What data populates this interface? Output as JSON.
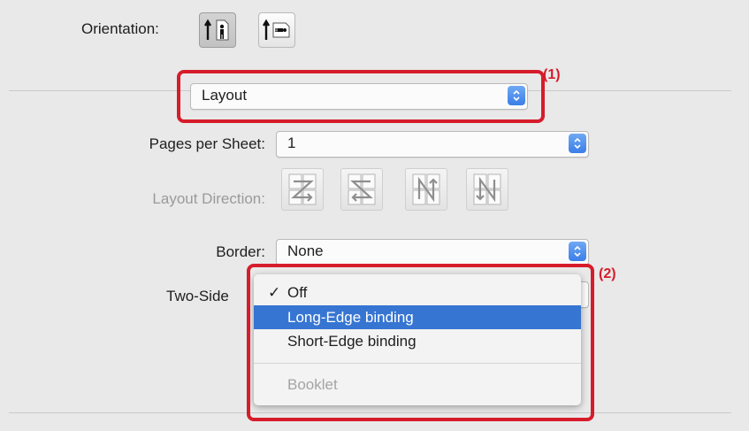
{
  "orientation": {
    "label": "Orientation:",
    "portrait_icon": "portrait-person-icon",
    "landscape_icon": "landscape-person-icon",
    "selected": "portrait"
  },
  "section_popup": {
    "value": "Layout"
  },
  "pages_per_sheet": {
    "label": "Pages per Sheet:",
    "value": "1"
  },
  "layout_direction": {
    "label": "Layout Direction:",
    "icons": [
      "z-order-icon",
      "reverse-z-order-icon",
      "n-order-icon",
      "reverse-n-order-icon"
    ]
  },
  "border": {
    "label": "Border:",
    "value": "None"
  },
  "two_sided": {
    "label": "Two-Side",
    "menu": [
      {
        "label": "Off",
        "checked": true,
        "highlighted": false,
        "enabled": true
      },
      {
        "label": "Long-Edge binding",
        "checked": false,
        "highlighted": true,
        "enabled": true
      },
      {
        "label": "Short-Edge binding",
        "checked": false,
        "highlighted": false,
        "enabled": true
      },
      {
        "label": "Booklet",
        "checked": false,
        "highlighted": false,
        "enabled": false
      }
    ]
  },
  "callouts": {
    "c1": "(1)",
    "c2": "(2)"
  },
  "colors": {
    "callout_red": "#d61c2b",
    "menu_highlight": "#3675d2",
    "stepper_blue": "#3b7ee8",
    "panel_bg": "#e9e9e9"
  }
}
